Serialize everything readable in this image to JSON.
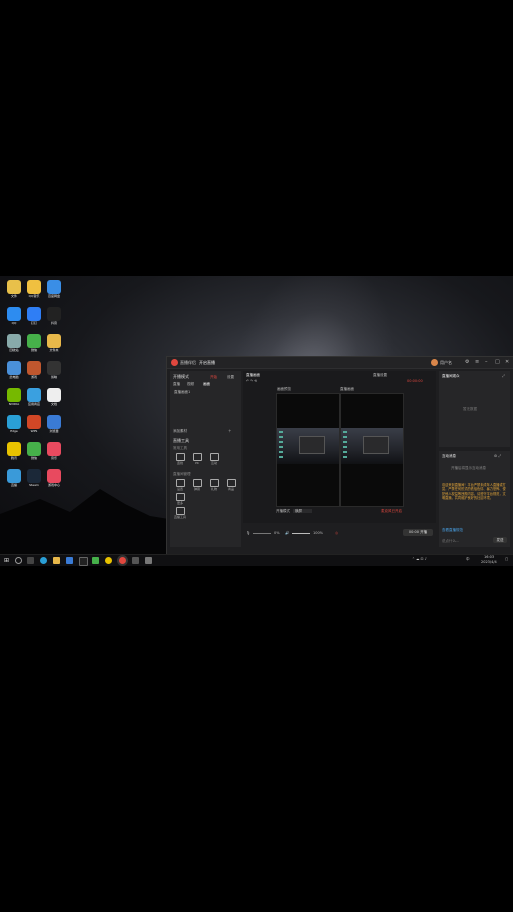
{
  "desktop": {
    "icons": [
      {
        "label": "文件",
        "color": "#e8c04a"
      },
      {
        "label": "QQ音乐",
        "color": "#f0c040"
      },
      {
        "label": "百度网盘",
        "color": "#3a8ee6"
      },
      {
        "label": "QQ",
        "color": "#2d8cf0"
      },
      {
        "label": "钉钉",
        "color": "#2f7ef5"
      },
      {
        "label": "抖音",
        "color": "#222"
      },
      {
        "label": "回收站",
        "color": "#8aa"
      },
      {
        "label": "微信",
        "color": "#46b04a"
      },
      {
        "label": "文件夹",
        "color": "#e8b84a"
      },
      {
        "label": "此电脑",
        "color": "#4a90d9"
      },
      {
        "label": "游戏",
        "color": "#c0572e"
      },
      {
        "label": "剪映",
        "color": "#333"
      },
      {
        "label": "NVIDIA",
        "color": "#76b900"
      },
      {
        "label": "应用商店",
        "color": "#3aa0e0"
      },
      {
        "label": "文档",
        "color": "#eee"
      },
      {
        "label": "Edge",
        "color": "#2a9fd6"
      },
      {
        "label": "WPS",
        "color": "#d24726"
      },
      {
        "label": "浏览器",
        "color": "#3a7bd5"
      },
      {
        "label": "腾讯",
        "color": "#e8c200"
      },
      {
        "label": "微信",
        "color": "#46b04a"
      },
      {
        "label": "音乐",
        "color": "#e84a5f"
      },
      {
        "label": "直播",
        "color": "#3a9ad9"
      },
      {
        "label": "Steam",
        "color": "#1b2838"
      },
      {
        "label": "游戏中心",
        "color": "#e84a5f"
      }
    ]
  },
  "window": {
    "app_name": "直播伴侣",
    "tab": "开启直播",
    "username": "用户名",
    "left": {
      "section1_title": "开播模式",
      "section1_action": "开始",
      "section1_action2": "设置",
      "tabs": [
        "直播",
        "视频",
        "画面"
      ],
      "scene_item": "直播画面1",
      "add_label": "添加素材",
      "tools_title": "直播工具",
      "sub1": "常用工具",
      "tools1": [
        "连线",
        "PK",
        "互动"
      ],
      "sub2": "直播间管理",
      "tools2": [
        "设置",
        "弹幕",
        "礼物",
        "商品",
        "更多"
      ],
      "tools3": [
        "直播工具"
      ]
    },
    "center": {
      "header_left": "直播画面",
      "header_right": "直播设置",
      "live_time": "00:00:00",
      "preview_labels": [
        "画面预览",
        "直播画面"
      ],
      "mode_label": "开播模式",
      "mode_value": "横屏",
      "red_hint": "麦克风已开启",
      "volume1": "0%",
      "volume2": "100%",
      "start_button": "00:00 开播"
    },
    "right": {
      "top_title": "直播间观众",
      "empty_hint": "暂无数据",
      "bottom_title": "互动消息",
      "notice": "开播后将显示互动消息",
      "chat_text": "欢迎来到直播间！平台严禁未成年人直播或打赏，严禁任何形式的低俗色情、暴力恐怖、侵犯他人权益等违规内容，请遵守平台规范，文明直播，共同维护良好的社区环境。",
      "link_text": "查看直播规范",
      "input_placeholder": "说点什么...",
      "send_label": "发送"
    }
  },
  "taskbar": {
    "clock_time": "16:03",
    "clock_date": "2023/4/4",
    "tray_text": "中"
  }
}
